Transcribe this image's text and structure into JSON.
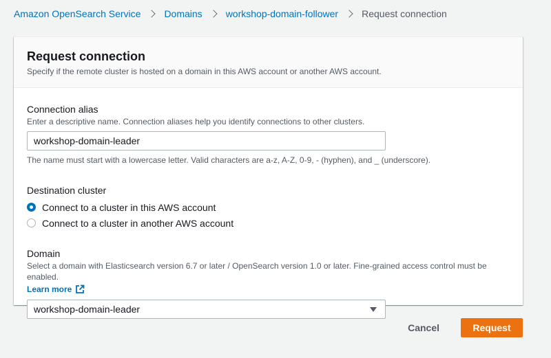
{
  "breadcrumb": {
    "items": [
      "Amazon OpenSearch Service",
      "Domains",
      "workshop-domain-follower"
    ],
    "current": "Request connection"
  },
  "header": {
    "title": "Request connection",
    "description": "Specify if the remote cluster is hosted on a domain in this AWS account or another AWS account."
  },
  "alias": {
    "label": "Connection alias",
    "description": "Enter a descriptive name. Connection aliases help you identify connections to other clusters.",
    "value": "workshop-domain-leader",
    "constraint": "The name must start with a lowercase letter. Valid characters are a-z, A-Z, 0-9, - (hyphen), and _ (underscore)."
  },
  "destination": {
    "label": "Destination cluster",
    "options": [
      "Connect to a cluster in this AWS account",
      "Connect to a cluster in another AWS account"
    ],
    "selected": "Connect to a cluster in this AWS account"
  },
  "domain": {
    "label": "Domain",
    "description": "Select a domain with Elasticsearch version 6.7 or later / OpenSearch version 1.0 or later. Fine-grained access control must be enabled.",
    "learn_more": "Learn more",
    "selected": "workshop-domain-leader"
  },
  "actions": {
    "cancel": "Cancel",
    "request": "Request"
  },
  "colors": {
    "link": "#0073bb",
    "primary": "#ec7211",
    "background": "#f2f3f3"
  },
  "icons": {
    "separator": "chevron-right-icon",
    "external": "external-link-icon",
    "dropdown": "caret-down-icon"
  }
}
